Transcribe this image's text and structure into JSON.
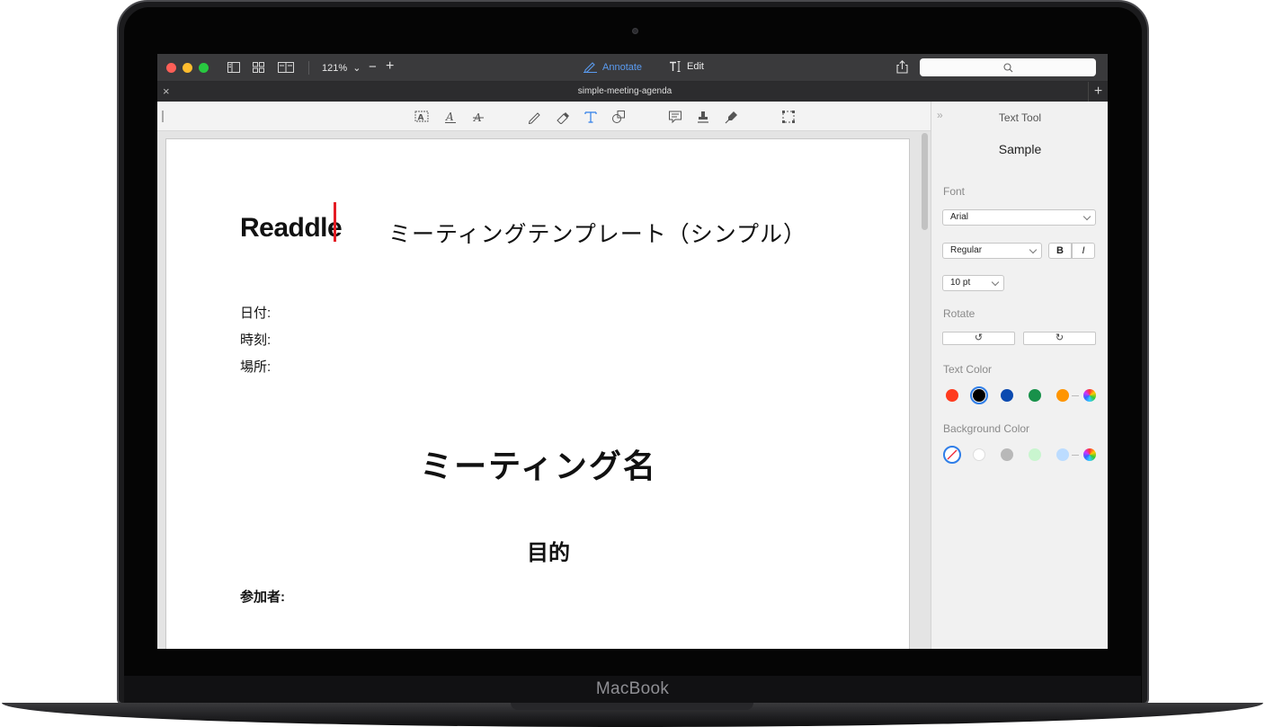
{
  "device": {
    "brand": "MacBook"
  },
  "app": {
    "titlebar": {
      "zoom": "121%",
      "modes": [
        {
          "label": "Annotate",
          "icon": "pencil-icon",
          "active": true
        },
        {
          "label": "Edit",
          "icon": "text-cursor-icon",
          "active": false
        }
      ],
      "search_placeholder": ""
    },
    "tab": {
      "title": "simple-meeting-agenda"
    },
    "toolbar": {
      "tools": [
        "text-highlight-icon",
        "text-underline-icon",
        "text-strikethrough-icon",
        "pencil-icon",
        "eraser-icon",
        "text-tool-icon",
        "shapes-icon",
        "note-icon",
        "stamp-icon",
        "signature-icon",
        "selection-icon"
      ],
      "active_tool": "text-tool-icon"
    },
    "document": {
      "logo": "Readdle",
      "title": "ミーティングテンプレート（シンプル）",
      "fields": [
        "日付:",
        "時刻:",
        "場所:"
      ],
      "meeting_name": "ミーティング名",
      "purpose": "目的",
      "participants": "参加者:"
    },
    "panel": {
      "title": "Text Tool",
      "sample": "Sample",
      "font_label": "Font",
      "font_value": "Arial",
      "weight_value": "Regular",
      "bold": "B",
      "italic": "I",
      "size_value": "10 pt",
      "rotate_label": "Rotate",
      "text_color_label": "Text Color",
      "text_colors": [
        "#ff3b1f",
        "#000000",
        "#0a4ab0",
        "#18914a",
        "#ff9500"
      ],
      "selected_text_color": "#000000",
      "background_color_label": "Background Color",
      "background_colors": [
        "none",
        "#ffffff",
        "#b8b8b8",
        "#c9f5cf",
        "#bcdcff"
      ]
    }
  }
}
